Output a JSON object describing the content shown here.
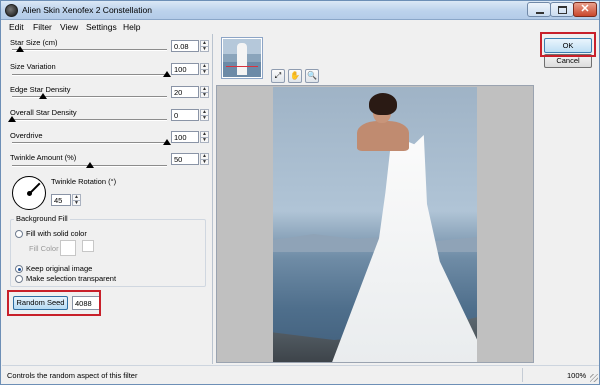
{
  "window": {
    "title": "Alien Skin Xenofex 2 Constellation",
    "buttons": {
      "minimize": "minimize",
      "maximize": "maximize",
      "close": "✕"
    }
  },
  "menu": [
    "Edit",
    "Filter",
    "View",
    "Settings",
    "Help"
  ],
  "params": [
    {
      "label": "Star Size (cm)",
      "value": "0.08",
      "level": 0.05
    },
    {
      "label": "Size Variation",
      "value": "100",
      "level": 1.0
    },
    {
      "label": "Edge Star Density",
      "value": "20",
      "level": 0.2
    },
    {
      "label": "Overall Star Density",
      "value": "0",
      "level": 0.0
    },
    {
      "label": "Overdrive",
      "value": "100",
      "level": 1.0
    },
    {
      "label": "Twinkle Amount (%)",
      "value": "50",
      "level": 0.5
    }
  ],
  "twinkle_rotation": {
    "label": "Twinkle Rotation (°)",
    "value": "45"
  },
  "background_fill": {
    "title": "Background Fill",
    "options": [
      {
        "label": "Fill with solid color",
        "selected": false
      },
      {
        "label": "Keep original image",
        "selected": true
      },
      {
        "label": "Make selection transparent",
        "selected": false
      }
    ],
    "fill_color_label": "Fill Color"
  },
  "random_seed": {
    "button_label": "Random Seed",
    "value": "4088"
  },
  "actions": {
    "ok": "OK",
    "cancel": "Cancel"
  },
  "tools": {
    "zoom_fit": "⤢",
    "hand": "✋",
    "zoom": "🔍"
  },
  "status": {
    "hint": "Controls the random aspect of this filter",
    "zoom": "100%"
  },
  "colors": {
    "highlight": "#c8202a",
    "accent_button": "#bfdff4"
  }
}
